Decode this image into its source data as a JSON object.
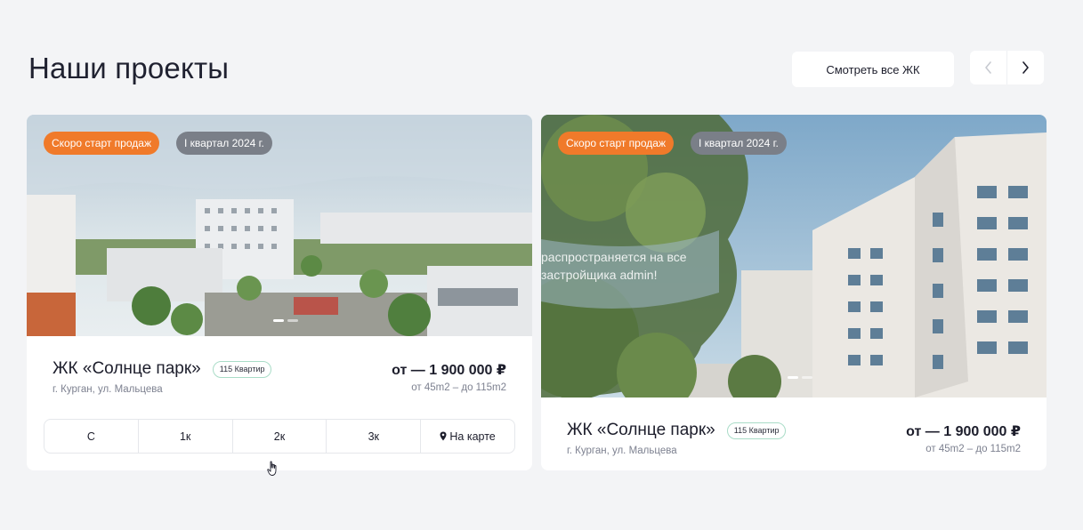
{
  "header": {
    "title": "Наши проекты",
    "view_all_label": "Смотреть все ЖК",
    "prev_icon": "chevron-left-icon",
    "next_icon": "chevron-right-icon"
  },
  "projects": [
    {
      "badges": [
        "Скоро старт продаж",
        "I квартал 2024 г."
      ],
      "name": "ЖК «Солнце парк»",
      "units_badge": "115 Квартир",
      "address": "г. Курган, ул. Мальцева",
      "price": "от — 1 900 000 ₽",
      "area": "от 45m2 – до 115m2",
      "filters": [
        "С",
        "1к",
        "2к",
        "3к",
        "На карте"
      ],
      "map_icon": "map-pin-icon"
    },
    {
      "badges": [
        "Скоро старт продаж",
        "I квартал 2024 г."
      ],
      "overlay_text": "распространяется на все застройщика admin!",
      "name": "ЖК «Солнце парк»",
      "units_badge": "115 Квартир",
      "address": "г. Курган, ул. Мальцева",
      "price": "от — 1 900 000 ₽",
      "area": "от 45m2 – до 115m2"
    }
  ],
  "colors": {
    "background": "#f3f4f6",
    "accent_orange": "#f07a2a",
    "badge_gray": "#7a7f88",
    "units_badge_border": "#a9dcc7"
  }
}
